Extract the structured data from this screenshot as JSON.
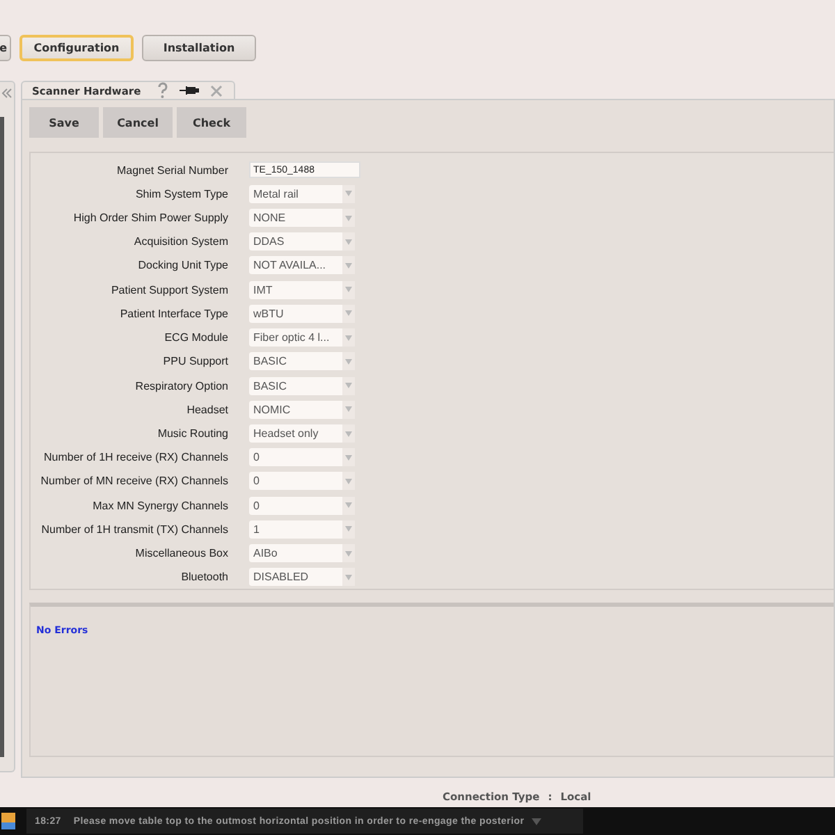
{
  "top_tabs": [
    {
      "label": "e",
      "selected": false
    },
    {
      "label": "Configuration",
      "selected": true
    },
    {
      "label": "Installation",
      "selected": false
    }
  ],
  "panel_tab": {
    "title": "Scanner Hardware"
  },
  "toolbar": [
    "Save",
    "Cancel",
    "Check"
  ],
  "fields": [
    {
      "label": "Magnet Serial Number",
      "kind": "text",
      "value": "TE_150_1488"
    },
    {
      "label": "Shim System Type",
      "kind": "dropdown",
      "value": "Metal rail"
    },
    {
      "label": "High Order Shim Power Supply",
      "kind": "dropdown",
      "value": "NONE"
    },
    {
      "label": "Acquisition System",
      "kind": "dropdown",
      "value": "DDAS"
    },
    {
      "label": "Docking Unit Type",
      "kind": "dropdown",
      "value": "NOT AVAILA..."
    },
    {
      "label": "Patient Support System",
      "kind": "dropdown",
      "value": "IMT"
    },
    {
      "label": "Patient Interface Type",
      "kind": "dropdown",
      "value": "wBTU"
    },
    {
      "label": "ECG Module",
      "kind": "dropdown",
      "value": "Fiber optic 4 l..."
    },
    {
      "label": "PPU Support",
      "kind": "dropdown",
      "value": "BASIC"
    },
    {
      "label": "Respiratory Option",
      "kind": "dropdown",
      "value": "BASIC"
    },
    {
      "label": "Headset",
      "kind": "dropdown",
      "value": "NOMIC"
    },
    {
      "label": "Music Routing",
      "kind": "dropdown",
      "value": "Headset only"
    },
    {
      "label": "Number of 1H receive (RX) Channels",
      "kind": "dropdown",
      "value": "0"
    },
    {
      "label": "Number of MN receive (RX) Channels",
      "kind": "dropdown",
      "value": "0"
    },
    {
      "label": "Max MN Synergy Channels",
      "kind": "dropdown",
      "value": "0"
    },
    {
      "label": "Number of 1H transmit (TX) Channels",
      "kind": "dropdown",
      "value": "1"
    },
    {
      "label": "Miscellaneous Box",
      "kind": "dropdown",
      "value": "AIBo"
    },
    {
      "label": "Bluetooth",
      "kind": "dropdown",
      "value": "DISABLED"
    }
  ],
  "messages": "No Errors",
  "connection": {
    "label": "Connection Type",
    "separator": ":",
    "value": "Local"
  },
  "taskbar": {
    "time": "18:27",
    "message": "Please move table top to the outmost horizontal position in order to re-engage the posterior"
  }
}
